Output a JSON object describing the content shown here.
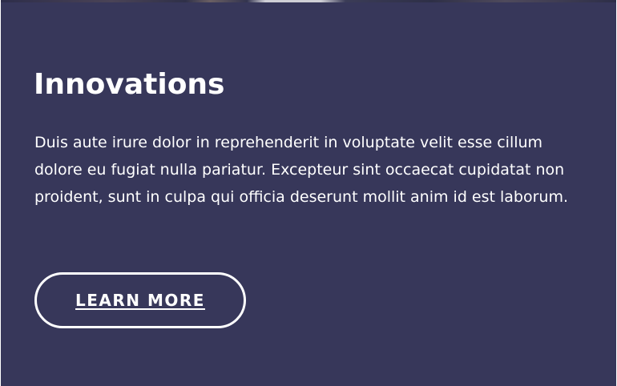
{
  "card": {
    "title": "Innovations",
    "body": "Duis aute irure dolor in reprehenderit in voluptate velit esse cillum dolore eu fugiat nulla pariatur. Excepteur sint occaecat cupidatat non proident, sunt in culpa qui officia deserunt mollit anim id est laborum.",
    "cta_label": "LEARN MORE"
  },
  "colors": {
    "background": "#37375a",
    "text": "#ffffff",
    "button_border": "#ffffff"
  }
}
